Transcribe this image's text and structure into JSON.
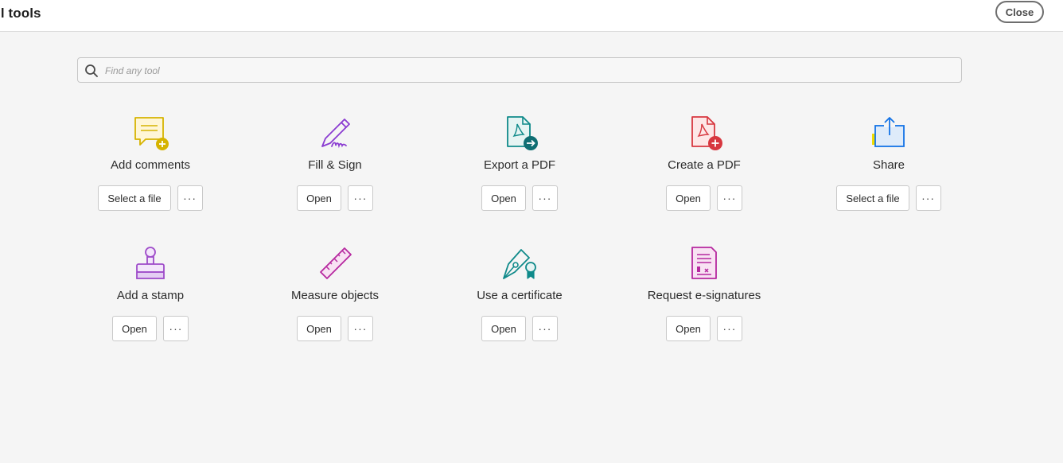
{
  "header": {
    "title": "ll tools",
    "close_label": "Close"
  },
  "search": {
    "placeholder": "Find any tool"
  },
  "more_label": "···",
  "tools": [
    {
      "name": "Add comments",
      "action": "Select a file",
      "icon": "comment-add-icon",
      "color": "#d6b300"
    },
    {
      "name": "Fill & Sign",
      "action": "Open",
      "icon": "pen-sign-icon",
      "color": "#8a3bd1"
    },
    {
      "name": "Export a PDF",
      "action": "Open",
      "icon": "export-pdf-icon",
      "color": "#0f8a8a"
    },
    {
      "name": "Create a PDF",
      "action": "Open",
      "icon": "create-pdf-icon",
      "color": "#d7373f"
    },
    {
      "name": "Share",
      "action": "Select a file",
      "icon": "share-icon",
      "color": "#1473e6"
    },
    {
      "name": "Add a stamp",
      "action": "Open",
      "icon": "stamp-icon",
      "color": "#9e4bc9"
    },
    {
      "name": "Measure objects",
      "action": "Open",
      "icon": "ruler-icon",
      "color": "#b6289f"
    },
    {
      "name": "Use a certificate",
      "action": "Open",
      "icon": "certificate-icon",
      "color": "#0f8a8a"
    },
    {
      "name": "Request e-signatures",
      "action": "Open",
      "icon": "request-esign-icon",
      "color": "#b6289f"
    }
  ]
}
